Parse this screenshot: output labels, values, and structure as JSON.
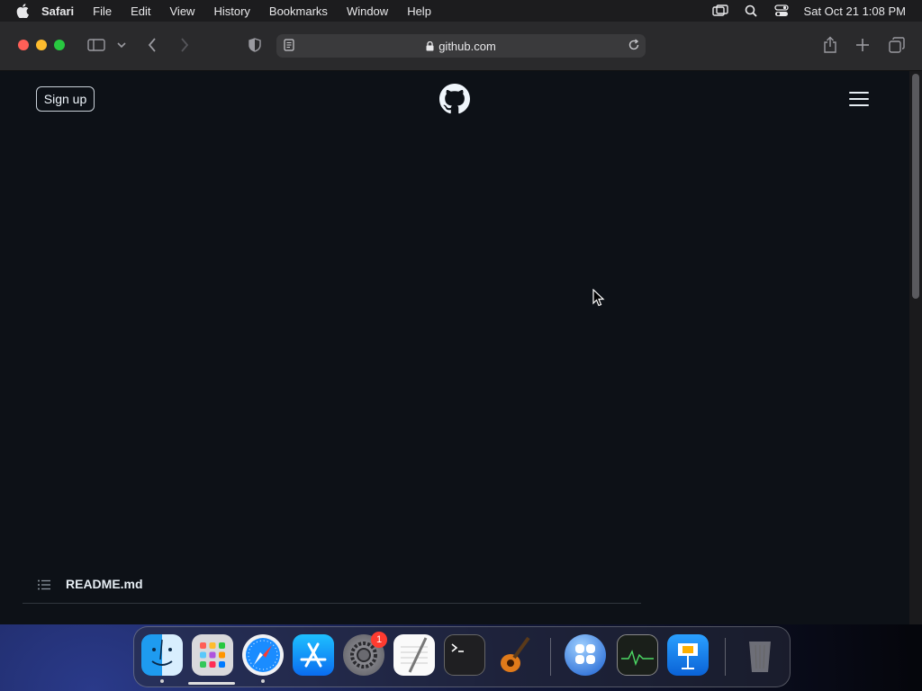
{
  "menubar": {
    "app_name": "Safari",
    "items": [
      "File",
      "Edit",
      "View",
      "History",
      "Bookmarks",
      "Window",
      "Help"
    ],
    "clock": "Sat Oct 21  1:08 PM",
    "status_icons": [
      "screen-mirroring-icon",
      "spotlight-search-icon",
      "control-center-icon"
    ]
  },
  "browser": {
    "url": "github.com",
    "toolbar_icons": [
      "sidebar-icon",
      "chevron-down-icon",
      "back-icon",
      "forward-icon",
      "privacy-shield-icon",
      "reader-icon",
      "reload-icon",
      "share-icon",
      "new-tab-icon",
      "tab-overview-icon"
    ]
  },
  "page": {
    "signup_label": "Sign up",
    "readme_label": "README.md"
  },
  "dock": {
    "apps": [
      "Finder",
      "Launchpad",
      "Safari",
      "App Store",
      "System Settings",
      "TextEdit",
      "Terminal",
      "GarageBand",
      "Mosaic",
      "Activity Monitor",
      "Keynote",
      "Trash"
    ],
    "system_settings_badge": "1"
  },
  "colors": {
    "page_bg": "#0d1117",
    "toolbar_bg": "#2a2a2c",
    "menubar_bg": "#1c1c1e"
  }
}
